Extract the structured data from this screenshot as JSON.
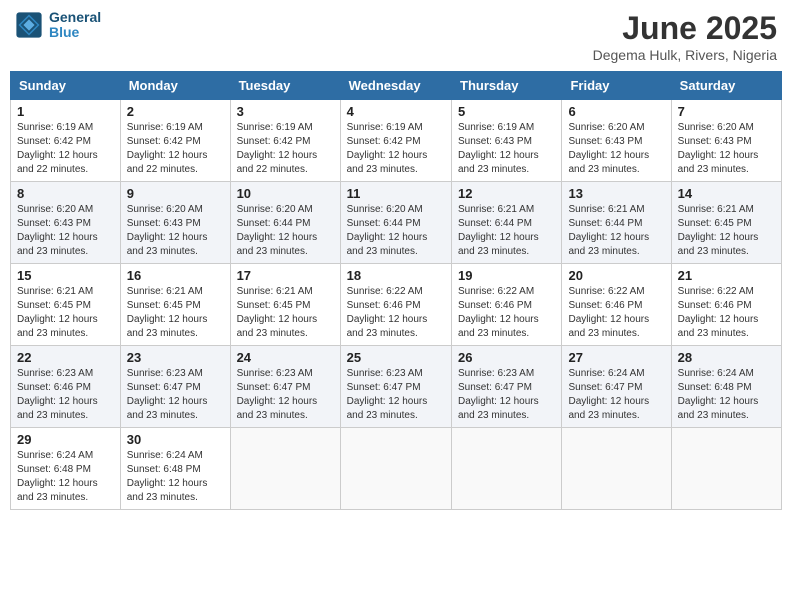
{
  "header": {
    "logo_line1": "General",
    "logo_line2": "Blue",
    "month_year": "June 2025",
    "location": "Degema Hulk, Rivers, Nigeria"
  },
  "days_of_week": [
    "Sunday",
    "Monday",
    "Tuesday",
    "Wednesday",
    "Thursday",
    "Friday",
    "Saturday"
  ],
  "weeks": [
    [
      {
        "day": "1",
        "sunrise": "6:19 AM",
        "sunset": "6:42 PM",
        "daylight": "12 hours and 22 minutes."
      },
      {
        "day": "2",
        "sunrise": "6:19 AM",
        "sunset": "6:42 PM",
        "daylight": "12 hours and 22 minutes."
      },
      {
        "day": "3",
        "sunrise": "6:19 AM",
        "sunset": "6:42 PM",
        "daylight": "12 hours and 22 minutes."
      },
      {
        "day": "4",
        "sunrise": "6:19 AM",
        "sunset": "6:42 PM",
        "daylight": "12 hours and 23 minutes."
      },
      {
        "day": "5",
        "sunrise": "6:19 AM",
        "sunset": "6:43 PM",
        "daylight": "12 hours and 23 minutes."
      },
      {
        "day": "6",
        "sunrise": "6:20 AM",
        "sunset": "6:43 PM",
        "daylight": "12 hours and 23 minutes."
      },
      {
        "day": "7",
        "sunrise": "6:20 AM",
        "sunset": "6:43 PM",
        "daylight": "12 hours and 23 minutes."
      }
    ],
    [
      {
        "day": "8",
        "sunrise": "6:20 AM",
        "sunset": "6:43 PM",
        "daylight": "12 hours and 23 minutes."
      },
      {
        "day": "9",
        "sunrise": "6:20 AM",
        "sunset": "6:43 PM",
        "daylight": "12 hours and 23 minutes."
      },
      {
        "day": "10",
        "sunrise": "6:20 AM",
        "sunset": "6:44 PM",
        "daylight": "12 hours and 23 minutes."
      },
      {
        "day": "11",
        "sunrise": "6:20 AM",
        "sunset": "6:44 PM",
        "daylight": "12 hours and 23 minutes."
      },
      {
        "day": "12",
        "sunrise": "6:21 AM",
        "sunset": "6:44 PM",
        "daylight": "12 hours and 23 minutes."
      },
      {
        "day": "13",
        "sunrise": "6:21 AM",
        "sunset": "6:44 PM",
        "daylight": "12 hours and 23 minutes."
      },
      {
        "day": "14",
        "sunrise": "6:21 AM",
        "sunset": "6:45 PM",
        "daylight": "12 hours and 23 minutes."
      }
    ],
    [
      {
        "day": "15",
        "sunrise": "6:21 AM",
        "sunset": "6:45 PM",
        "daylight": "12 hours and 23 minutes."
      },
      {
        "day": "16",
        "sunrise": "6:21 AM",
        "sunset": "6:45 PM",
        "daylight": "12 hours and 23 minutes."
      },
      {
        "day": "17",
        "sunrise": "6:21 AM",
        "sunset": "6:45 PM",
        "daylight": "12 hours and 23 minutes."
      },
      {
        "day": "18",
        "sunrise": "6:22 AM",
        "sunset": "6:46 PM",
        "daylight": "12 hours and 23 minutes."
      },
      {
        "day": "19",
        "sunrise": "6:22 AM",
        "sunset": "6:46 PM",
        "daylight": "12 hours and 23 minutes."
      },
      {
        "day": "20",
        "sunrise": "6:22 AM",
        "sunset": "6:46 PM",
        "daylight": "12 hours and 23 minutes."
      },
      {
        "day": "21",
        "sunrise": "6:22 AM",
        "sunset": "6:46 PM",
        "daylight": "12 hours and 23 minutes."
      }
    ],
    [
      {
        "day": "22",
        "sunrise": "6:23 AM",
        "sunset": "6:46 PM",
        "daylight": "12 hours and 23 minutes."
      },
      {
        "day": "23",
        "sunrise": "6:23 AM",
        "sunset": "6:47 PM",
        "daylight": "12 hours and 23 minutes."
      },
      {
        "day": "24",
        "sunrise": "6:23 AM",
        "sunset": "6:47 PM",
        "daylight": "12 hours and 23 minutes."
      },
      {
        "day": "25",
        "sunrise": "6:23 AM",
        "sunset": "6:47 PM",
        "daylight": "12 hours and 23 minutes."
      },
      {
        "day": "26",
        "sunrise": "6:23 AM",
        "sunset": "6:47 PM",
        "daylight": "12 hours and 23 minutes."
      },
      {
        "day": "27",
        "sunrise": "6:24 AM",
        "sunset": "6:47 PM",
        "daylight": "12 hours and 23 minutes."
      },
      {
        "day": "28",
        "sunrise": "6:24 AM",
        "sunset": "6:48 PM",
        "daylight": "12 hours and 23 minutes."
      }
    ],
    [
      {
        "day": "29",
        "sunrise": "6:24 AM",
        "sunset": "6:48 PM",
        "daylight": "12 hours and 23 minutes."
      },
      {
        "day": "30",
        "sunrise": "6:24 AM",
        "sunset": "6:48 PM",
        "daylight": "12 hours and 23 minutes."
      },
      null,
      null,
      null,
      null,
      null
    ]
  ]
}
